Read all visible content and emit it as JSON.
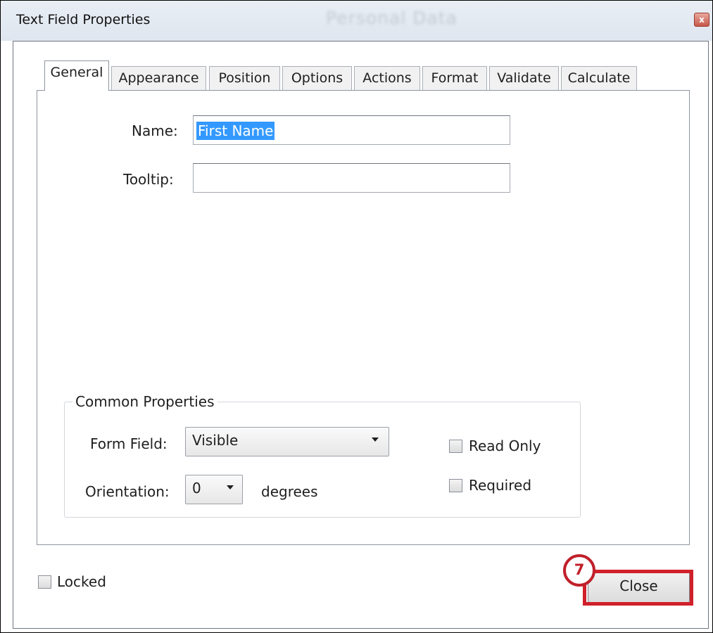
{
  "window": {
    "title": "Text Field Properties",
    "background_title": "Personal Data",
    "close_glyph": "x"
  },
  "tabs": [
    {
      "label": "General",
      "active": true
    },
    {
      "label": "Appearance",
      "active": false
    },
    {
      "label": "Position",
      "active": false
    },
    {
      "label": "Options",
      "active": false
    },
    {
      "label": "Actions",
      "active": false
    },
    {
      "label": "Format",
      "active": false
    },
    {
      "label": "Validate",
      "active": false
    },
    {
      "label": "Calculate",
      "active": false
    }
  ],
  "general": {
    "name_label": "Name:",
    "name_value": "First Name",
    "tooltip_label": "Tooltip:",
    "tooltip_value": ""
  },
  "common_properties": {
    "legend": "Common Properties",
    "form_field_label": "Form Field:",
    "form_field_value": "Visible",
    "orientation_label": "Orientation:",
    "orientation_value": "0",
    "orientation_unit": "degrees",
    "read_only_label": "Read Only",
    "read_only_checked": false,
    "required_label": "Required",
    "required_checked": false
  },
  "footer": {
    "locked_label": "Locked",
    "locked_checked": false,
    "close_label": "Close"
  },
  "annotation": {
    "step_number": "7",
    "color": "#d0202a"
  },
  "colors": {
    "selection": "#3399ff",
    "titlebar": "#e5ebf3"
  }
}
